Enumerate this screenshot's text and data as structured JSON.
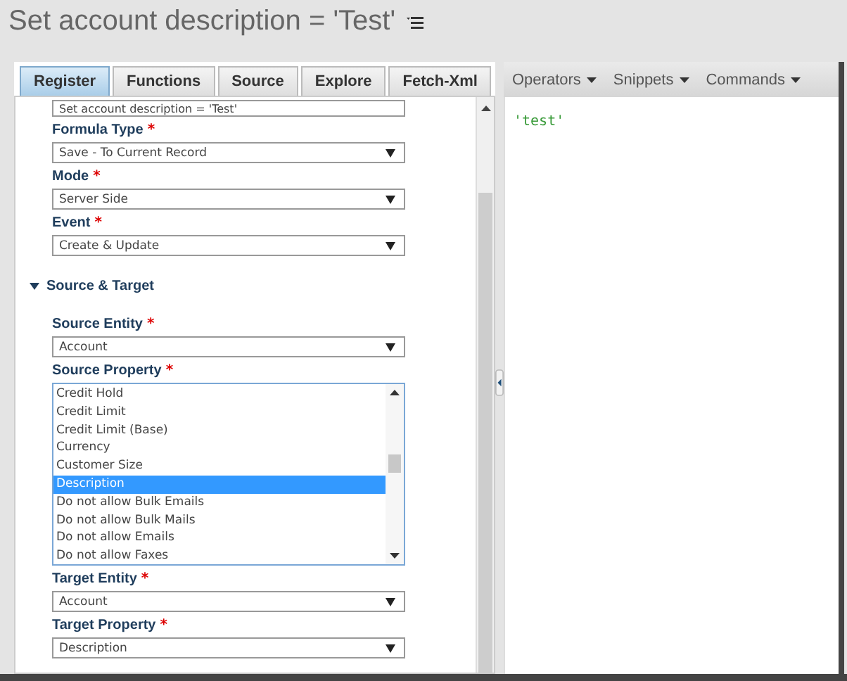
{
  "title": "Set account description = 'Test'",
  "tabs": [
    {
      "label": "Register",
      "selected": true
    },
    {
      "label": "Functions",
      "selected": false
    },
    {
      "label": "Source",
      "selected": false
    },
    {
      "label": "Explore",
      "selected": false
    },
    {
      "label": "Fetch-Xml",
      "selected": false
    }
  ],
  "toolbar": [
    {
      "label": "Operators"
    },
    {
      "label": "Snippets"
    },
    {
      "label": "Commands"
    }
  ],
  "editor": {
    "code": "'test'"
  },
  "form_items": [
    {
      "kind": "text",
      "value": "Set account description = 'Test'"
    },
    {
      "kind": "select",
      "label": "Formula Type",
      "required_mark": "*",
      "value": "Save - To Current Record"
    },
    {
      "kind": "select",
      "label": "Mode",
      "required_mark": "*",
      "value": "Server Side"
    },
    {
      "kind": "select",
      "label": "Event",
      "required_mark": "*",
      "value": "Create & Update"
    },
    {
      "kind": "section",
      "label": "Source & Target",
      "expanded": true
    },
    {
      "kind": "select",
      "label": "Source Entity",
      "required_mark": "*",
      "value": "Account"
    },
    {
      "kind": "listbox",
      "label": "Source Property",
      "required_mark": "*",
      "options": [
        {
          "label": "Credit Hold",
          "selected": false
        },
        {
          "label": "Credit Limit",
          "selected": false
        },
        {
          "label": "Credit Limit (Base)",
          "selected": false
        },
        {
          "label": "Currency",
          "selected": false
        },
        {
          "label": "Customer Size",
          "selected": false
        },
        {
          "label": "Description",
          "selected": true
        },
        {
          "label": "Do not allow Bulk Emails",
          "selected": false
        },
        {
          "label": "Do not allow Bulk Mails",
          "selected": false
        },
        {
          "label": "Do not allow Emails",
          "selected": false
        },
        {
          "label": "Do not allow Faxes",
          "selected": false
        }
      ]
    },
    {
      "kind": "select",
      "label": "Target Entity",
      "required_mark": "*",
      "value": "Account"
    },
    {
      "kind": "select",
      "label": "Target Property",
      "required_mark": "*",
      "value": "Description"
    }
  ]
}
